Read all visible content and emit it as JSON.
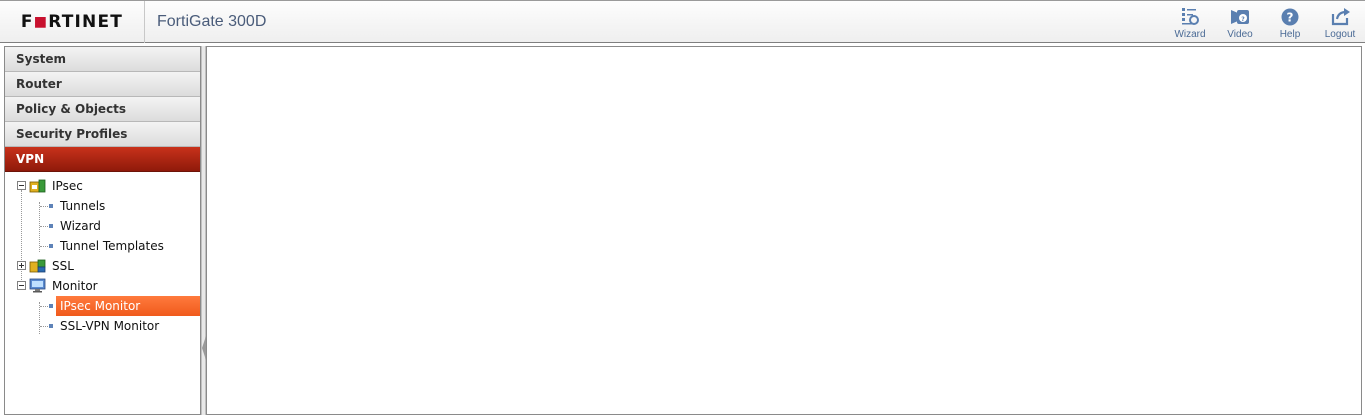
{
  "header": {
    "logo_text_pre": "F",
    "logo_text_o": "■",
    "logo_text_post": "RTINET",
    "device_name": "FortiGate 300D",
    "tools": [
      {
        "label": "Wizard",
        "icon": "wizard-icon"
      },
      {
        "label": "Video",
        "icon": "video-icon"
      },
      {
        "label": "Help",
        "icon": "help-icon"
      },
      {
        "label": "Logout",
        "icon": "logout-icon"
      }
    ]
  },
  "sidebar": {
    "nav": [
      {
        "label": "System",
        "active": false
      },
      {
        "label": "Router",
        "active": false
      },
      {
        "label": "Policy & Objects",
        "active": false
      },
      {
        "label": "Security Profiles",
        "active": false
      },
      {
        "label": "VPN",
        "active": true
      }
    ],
    "tree": {
      "ipsec": {
        "label": "IPsec",
        "children": [
          "Tunnels",
          "Wizard",
          "Tunnel Templates"
        ]
      },
      "ssl": {
        "label": "SSL"
      },
      "monitor": {
        "label": "Monitor",
        "children": [
          "IPsec Monitor",
          "SSL-VPN Monitor"
        ],
        "selected": "IPsec Monitor"
      }
    }
  },
  "colors": {
    "brand_red": "#c8102e",
    "active_nav": "#b32a15",
    "selection": "#f4672a",
    "tool_label": "#4a6a95"
  }
}
